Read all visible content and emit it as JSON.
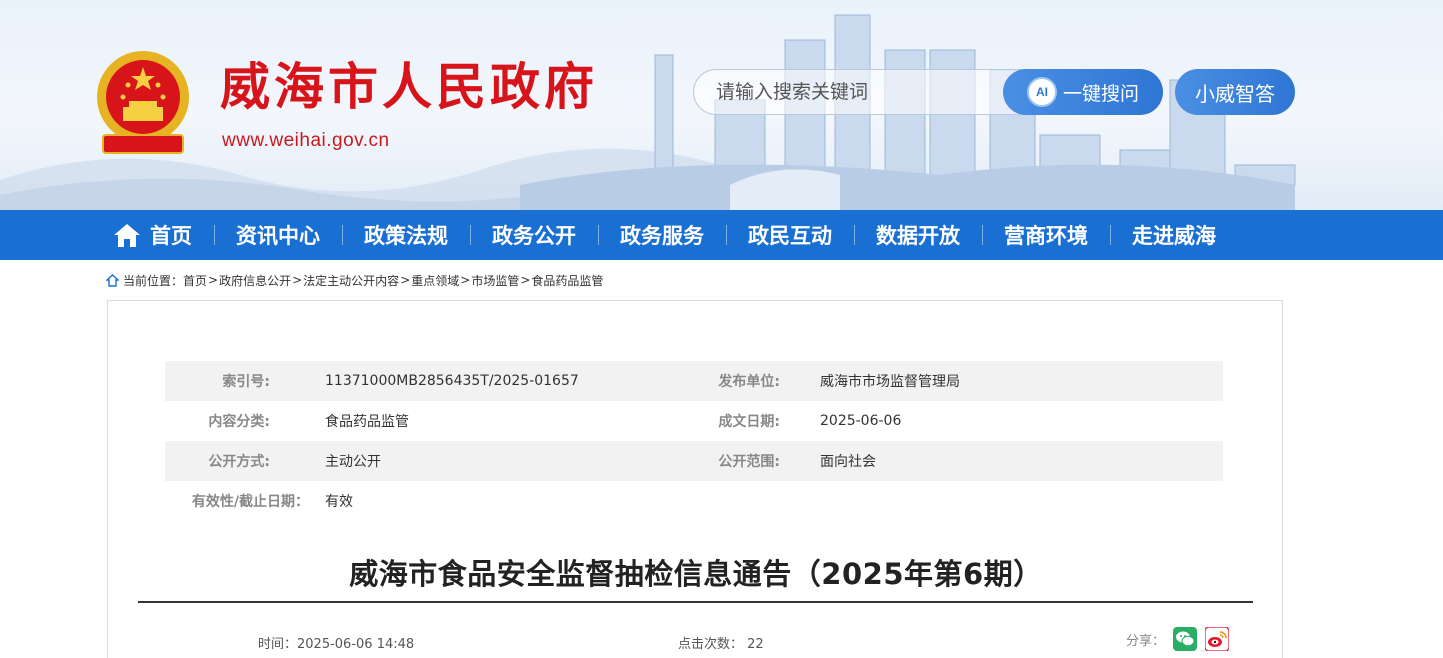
{
  "header": {
    "site_title": "威海市人民政府",
    "site_url": "www.weihai.gov.cn",
    "search_placeholder": "请输入搜索关键词",
    "search_button_ai": "AI",
    "search_button_label": "一键搜问",
    "assistant_button_label": "小威智答",
    "emblem_icon": "national-emblem-icon"
  },
  "nav": {
    "items": [
      {
        "label": "首页",
        "icon": "home-icon"
      },
      {
        "label": "资讯中心"
      },
      {
        "label": "政策法规"
      },
      {
        "label": "政务公开"
      },
      {
        "label": "政务服务"
      },
      {
        "label": "政民互动"
      },
      {
        "label": "数据开放"
      },
      {
        "label": "营商环境"
      },
      {
        "label": "走进威海"
      }
    ]
  },
  "breadcrumb": {
    "prefix": "当前位置：",
    "items": [
      "首页",
      "政府信息公开",
      "法定主动公开内容",
      "重点领域",
      "市场监管",
      "食品药品监管"
    ],
    "separator": ">"
  },
  "meta": {
    "index_label": "索引号:",
    "index_value": "11371000MB2856435T/2025-01657",
    "publisher_label": "发布单位:",
    "publisher_value": "威海市市场监督管理局",
    "category_label": "内容分类:",
    "category_value": "食品药品监管",
    "date_label": "成文日期:",
    "date_value": "2025-06-06",
    "disclosure_label": "公开方式:",
    "disclosure_value": "主动公开",
    "scope_label": "公开范围:",
    "scope_value": "面向社会",
    "validity_label": "有效性/截止日期：",
    "validity_value": "有效"
  },
  "article": {
    "title": "威海市食品安全监督抽检信息通告（2025年第6期）",
    "time_label": "时间：",
    "time_value": "2025-06-06 14:48",
    "clicks_label": "点击次数：",
    "clicks_value": "22",
    "share_label": "分享："
  },
  "colors": {
    "brand_red": "#d8141b",
    "nav_blue": "#1a6fd2",
    "button_blue": "#2f76d5",
    "wechat_green": "#2aae67",
    "weibo_red": "#e6162d"
  }
}
